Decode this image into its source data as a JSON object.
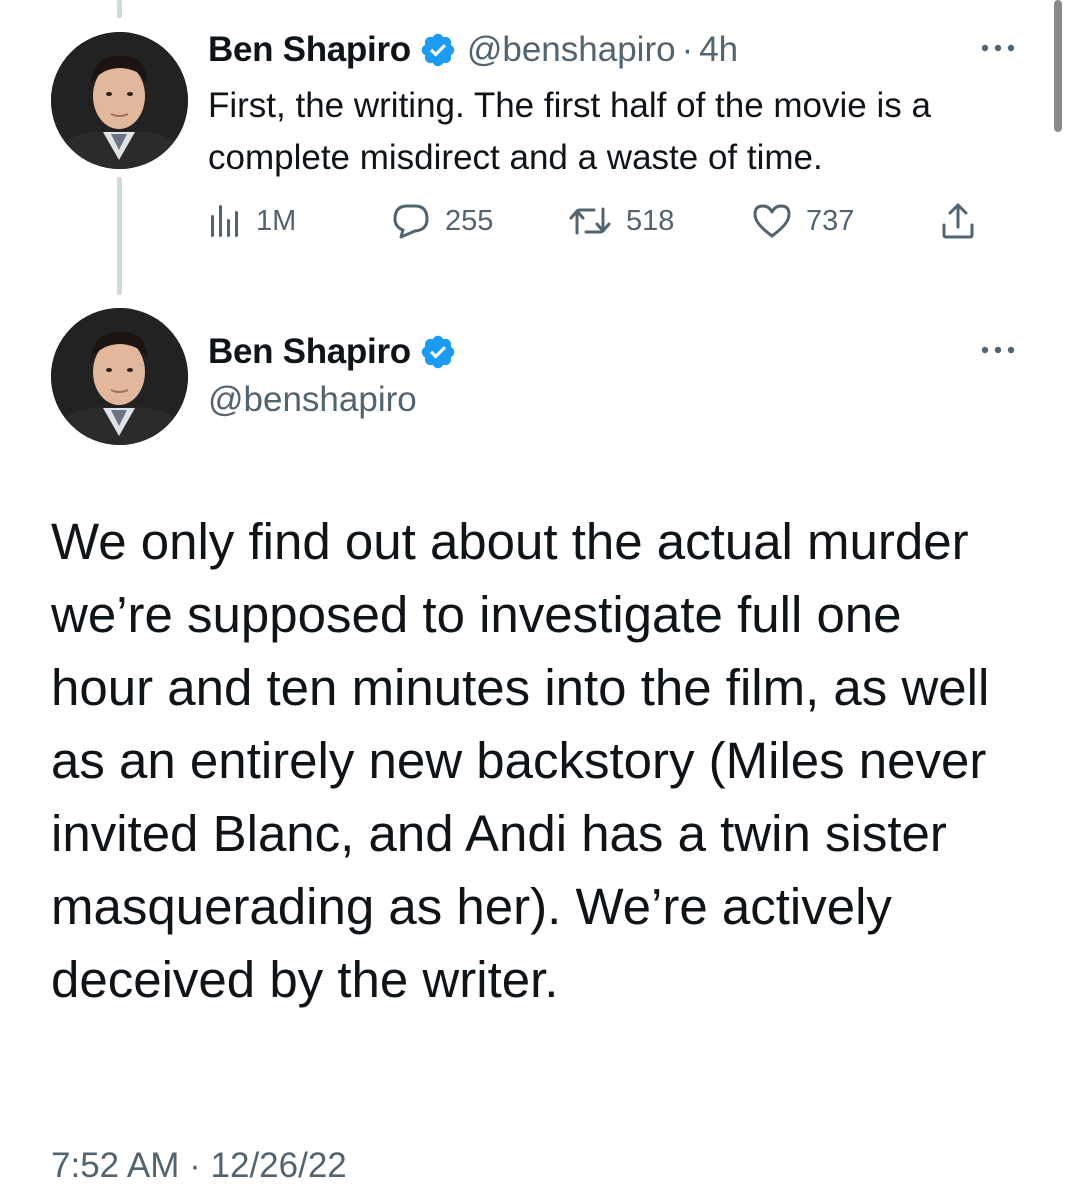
{
  "reply_tweet": {
    "author_name": "Ben Shapiro",
    "author_handle": "@benshapiro",
    "separator": "·",
    "time_ago": "4h",
    "text": "First, the writing. The first half of the movie is a complete misdirect and a waste of time.",
    "metrics": {
      "views": "1M",
      "replies": "255",
      "retweets": "518",
      "likes": "737"
    }
  },
  "main_tweet": {
    "author_name": "Ben Shapiro",
    "author_handle": "@benshapiro",
    "text": "We only find out about the actual murder we’re supposed to investigate full one hour and ten minutes into the film, as well as an entirely new backstory (Miles never invited Blanc, and Andi has a twin sister masquerading as her). We’re actively deceived by the writer.",
    "timestamp": "7:52 AM · 12/26/22"
  },
  "icons": {
    "verified": "verified-badge-icon",
    "more": "more-options-icon",
    "views": "views-bar-chart-icon",
    "reply": "reply-speech-bubble-icon",
    "retweet": "retweet-arrows-icon",
    "like": "heart-icon",
    "share": "share-upload-icon"
  },
  "colors": {
    "verified_blue": "#1d9bf0",
    "secondary_text": "#536471",
    "primary_text": "#0f1419",
    "thread_line": "#cfd9de"
  }
}
